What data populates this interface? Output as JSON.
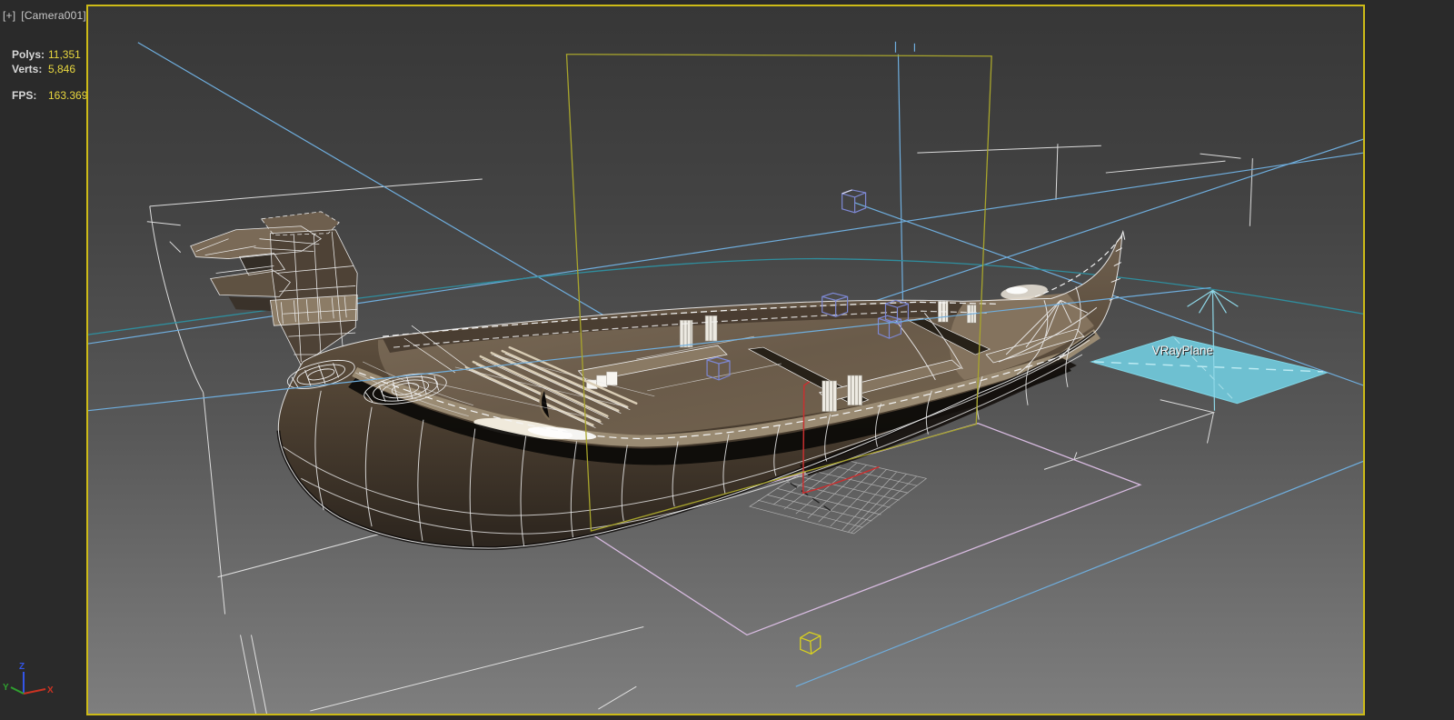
{
  "window": {
    "viewport_plus": "[+]",
    "viewport_camera": "[Camera001]"
  },
  "stats": {
    "polys_label": "Polys:",
    "polys_value": "11,351",
    "verts_label": "Verts:",
    "verts_value": "5,846",
    "fps_label": "FPS:",
    "fps_value": "163.369"
  },
  "scene": {
    "vrayplane_label": "VRayPlane"
  },
  "axis": {
    "x": "X",
    "y": "Y",
    "z": "Z"
  },
  "colors": {
    "viewport_border": "#CDBB17",
    "stat_label": "#D8D8D8",
    "stat_value": "#E8D73F",
    "viewport_label": "#C9C9C9",
    "background_top": "#373737",
    "background_bottom": "#7E7E7E",
    "wireframe_white": "#EFEFEF",
    "helper_blue_cube": "#7D88D4",
    "helper_yellow_cube": "#D8D020",
    "spline_yellow": "#A8A52C",
    "spline_pink": "#D9BCE2",
    "line_light_blue": "#6FAEDE",
    "line_teal": "#2F8E9E",
    "vrayplane_fill": "#6FC5D6",
    "selected_red": "#C83030",
    "axis_x": "#CC3322",
    "axis_y": "#2FA02F",
    "axis_z": "#3355E8"
  }
}
